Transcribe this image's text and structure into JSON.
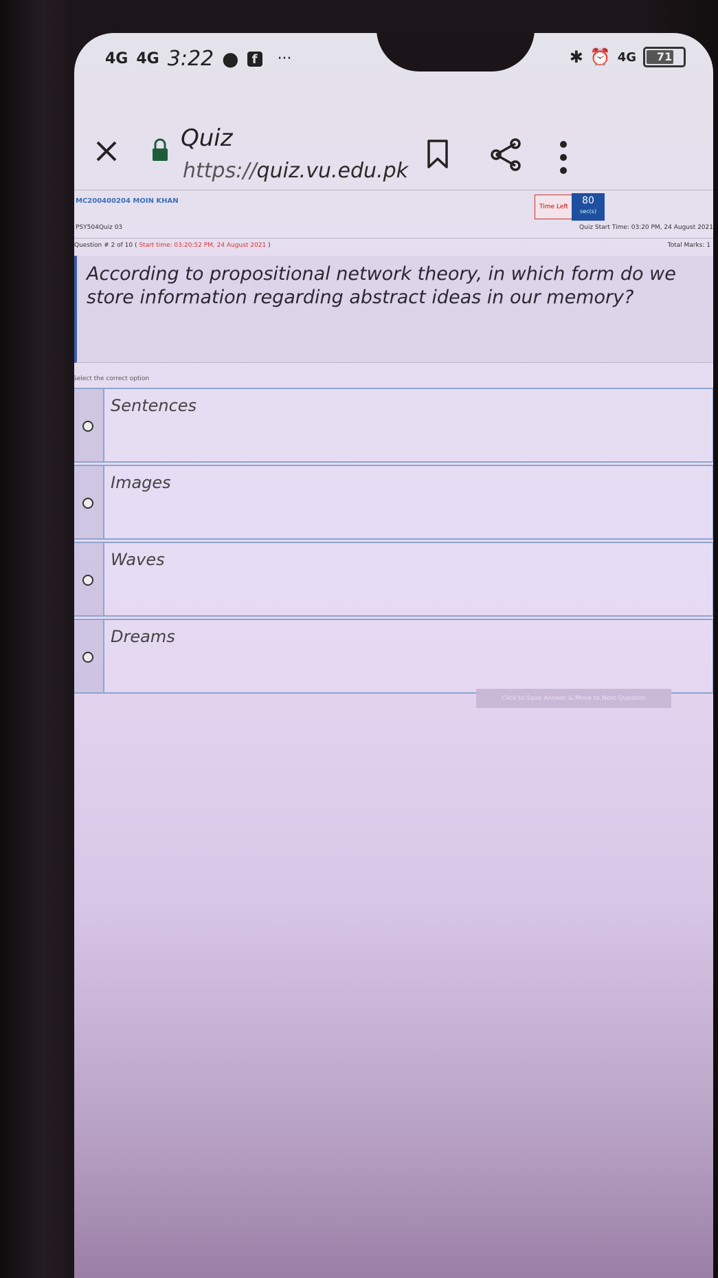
{
  "status_bar": {
    "signal1": "4G",
    "signal2": "4G",
    "time": "3:22",
    "extra": "···",
    "right_net": "4G",
    "battery": "71"
  },
  "browser": {
    "title": "Quiz",
    "url_protocol": "https://",
    "url_host": "quiz.vu.edu.pk"
  },
  "quiz_header": {
    "student": "MC200400204 MOIN KHAN",
    "time_left_label": "Time Left",
    "time_left_value": "80",
    "time_left_unit": "sec(s)",
    "course": "PSY504Quiz 03",
    "quiz_start_label": "Quiz Start Time:",
    "quiz_start_value": "03:20 PM, 24 August 2021"
  },
  "question": {
    "number_text": "Question # 2 of 10 (",
    "start_time": "Start time: 03:20:52 PM, 24 August 2021",
    "close_paren": ")",
    "total_marks": "Total Marks: 1",
    "text": "According to propositional network theory, in which form do we store information regarding abstract ideas in our memory?"
  },
  "select_label": "Select the correct option",
  "options": [
    {
      "label": "Sentences"
    },
    {
      "label": "Images"
    },
    {
      "label": "Waves"
    },
    {
      "label": "Dreams"
    }
  ],
  "submit_label": "Click to Save Answer & Move to Next Question"
}
